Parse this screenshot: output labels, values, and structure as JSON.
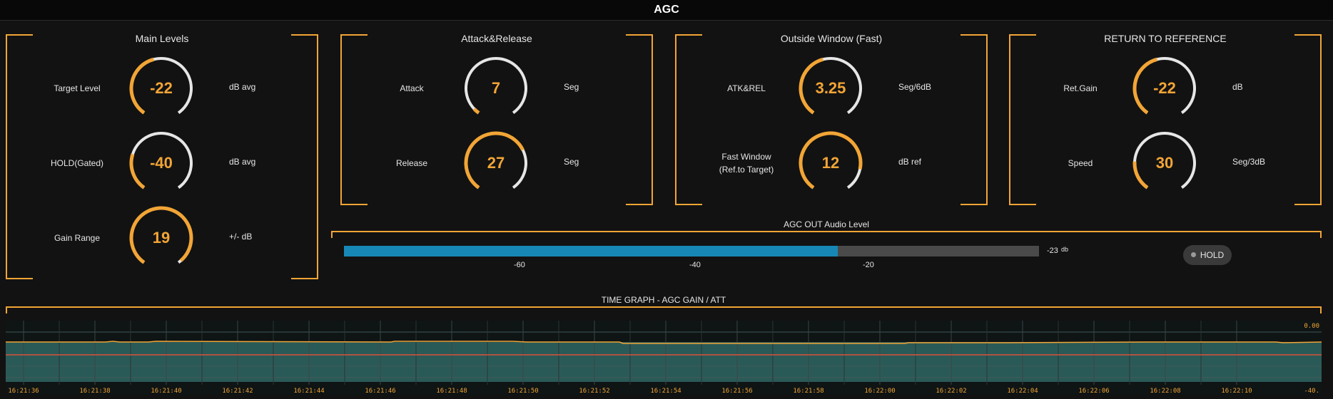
{
  "app": {
    "title": "AGC"
  },
  "colors": {
    "accent": "#f2a536",
    "knob_track": "#e6e6e6",
    "meter_fill": "#1788b6",
    "meter_bg": "#4a4a4a",
    "graph_fill": "#2a5a57",
    "ref_line": "#d9533b"
  },
  "panels": [
    {
      "title": "Main Levels",
      "knobs": [
        {
          "label": "Target Level",
          "value": "-22",
          "unit": "dB avg",
          "level": 0.45
        },
        {
          "label": "HOLD(Gated)",
          "value": "-40",
          "unit": "dB avg",
          "level": 0.25
        },
        {
          "label": "Gain Range",
          "value": "19",
          "unit": "+/- dB",
          "level": 0.98
        }
      ]
    },
    {
      "title": "Attack&Release",
      "knobs": [
        {
          "label": "Attack",
          "value": "7",
          "unit": "Seg",
          "level": 0.04
        },
        {
          "label": "Release",
          "value": "27",
          "unit": "Seg",
          "level": 0.72
        }
      ]
    },
    {
      "title": "Outside Window (Fast)",
      "knobs": [
        {
          "label": "ATK&REL",
          "value": "3.25",
          "unit": "Seg/6dB",
          "level": 0.45
        },
        {
          "label": "Fast Window",
          "label2": "(Ref.to Target)",
          "value": "12",
          "unit": "dB ref",
          "level": 0.85
        }
      ]
    },
    {
      "title": "RETURN TO REFERENCE",
      "knobs": [
        {
          "label": "Ret.Gain",
          "value": "-22",
          "unit": "dB",
          "level": 0.45
        },
        {
          "label": "Speed",
          "value": "30",
          "unit": "Seg/3dB",
          "level": 0.2
        }
      ]
    }
  ],
  "meter": {
    "title": "AGC OUT Audio Level",
    "value_label": "-23",
    "unit_label": "db",
    "level": 0.71,
    "ticks": [
      "-60",
      "-40",
      "-20"
    ],
    "hold_label": "HOLD"
  },
  "graph": {
    "title": "TIME GRAPH - AGC GAIN / ATT",
    "top_label": "0.00",
    "bottom_label": "-40.",
    "times": [
      "16:21:36",
      "16:21:38",
      "16:21:40",
      "16:21:42",
      "16:21:44",
      "16:21:46",
      "16:21:48",
      "16:21:50",
      "16:21:52",
      "16:21:54",
      "16:21:56",
      "16:21:58",
      "16:22:00",
      "16:22:02",
      "16:22:04",
      "16:22:06",
      "16:22:08",
      "16:22:10"
    ]
  }
}
